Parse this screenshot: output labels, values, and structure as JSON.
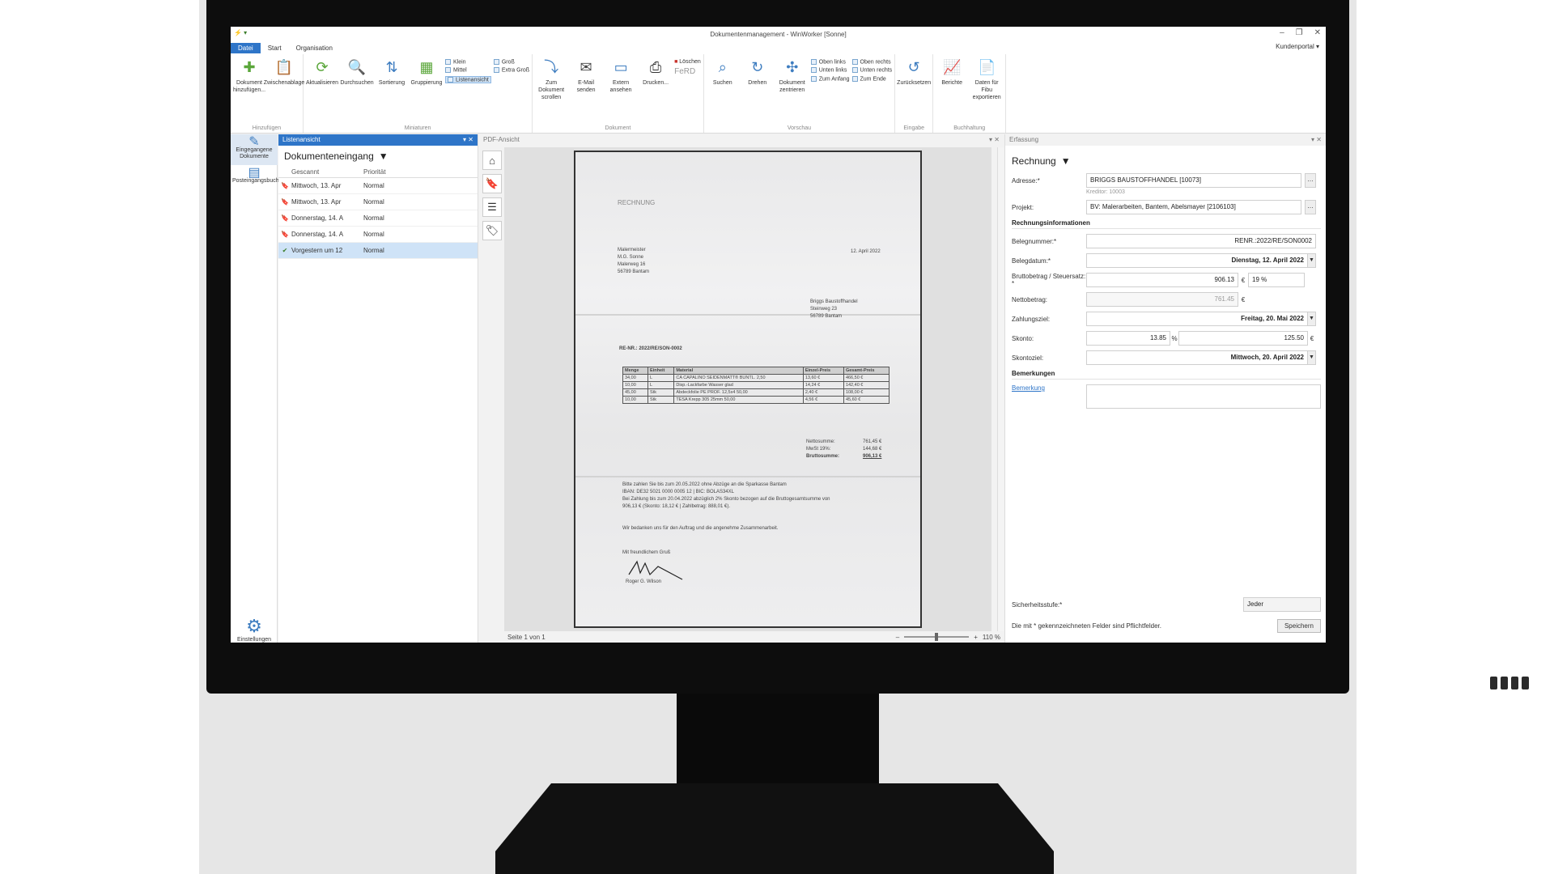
{
  "window": {
    "title": "Dokumentenmanagement - WinWorker [Sonne]",
    "quick_access": "⚡ ▾",
    "controls": [
      "–",
      "❐",
      "✕"
    ],
    "kundenportal": "Kundenportal ▾"
  },
  "menu": {
    "items": [
      "Datei",
      "Start",
      "Organisation"
    ],
    "active": "Datei"
  },
  "ribbon": {
    "groups": [
      {
        "label": "Hinzufügen",
        "buttons": [
          {
            "label": "Dokument hinzufügen...",
            "icon": "add-document-icon"
          },
          {
            "label": "Zwischenablage",
            "icon": "clipboard-icon"
          }
        ]
      },
      {
        "label": "Miniaturen",
        "buttons": [
          {
            "label": "Aktualisieren",
            "icon": "refresh-icon"
          },
          {
            "label": "Durchsuchen",
            "icon": "search-folder-icon"
          },
          {
            "label": "Sortierung",
            "icon": "sort-icon"
          },
          {
            "label": "Gruppierung",
            "icon": "group-icon"
          }
        ],
        "small": [
          "Klein",
          "Mittel",
          "Listenansicht",
          "Groß",
          "Extra Groß"
        ]
      },
      {
        "label": "Dokument",
        "buttons": [
          {
            "label": "Zum Dokument scrollen",
            "icon": "scroll-icon"
          },
          {
            "label": "E-Mail senden",
            "icon": "mail-icon"
          },
          {
            "label": "Extern ansehen",
            "icon": "external-icon"
          },
          {
            "label": "Drucken...",
            "icon": "print-icon"
          }
        ],
        "small": [
          "Löschen",
          "FeRD"
        ]
      },
      {
        "label": "Vorschau",
        "buttons": [
          {
            "label": "Suchen",
            "icon": "search-icon"
          },
          {
            "label": "Drehen",
            "icon": "rotate-icon"
          },
          {
            "label": "Dokument zentrieren",
            "icon": "center-icon"
          }
        ],
        "small": [
          "Oben links",
          "Unten links",
          "Zum Anfang",
          "Oben rechts",
          "Unten rechts",
          "Zum Ende"
        ]
      },
      {
        "label": "Eingabe",
        "buttons": [
          {
            "label": "Zurücksetzen",
            "icon": "reset-icon"
          }
        ]
      },
      {
        "label": "Buchhaltung",
        "buttons": [
          {
            "label": "Berichte",
            "icon": "report-icon"
          },
          {
            "label": "Daten für Fibu exportieren",
            "icon": "export-icon"
          }
        ]
      }
    ]
  },
  "nav": {
    "items": [
      {
        "label": "Eingegangene Dokumente",
        "icon": "inbox-icon"
      },
      {
        "label": "Posteingangsbuch",
        "icon": "book-icon"
      }
    ],
    "settings": "Einstellungen"
  },
  "list": {
    "pane_title": "Listenansicht",
    "view": "Dokumenteneingang",
    "columns": [
      "Gescannt",
      "Priorität"
    ],
    "rows": [
      {
        "scanned": "Mittwoch, 13. Apr",
        "priority": "Normal",
        "mark": "bookmark"
      },
      {
        "scanned": "Mittwoch, 13. Apr",
        "priority": "Normal",
        "mark": "bookmark"
      },
      {
        "scanned": "Donnerstag, 14. A",
        "priority": "Normal",
        "mark": "bookmark"
      },
      {
        "scanned": "Donnerstag, 14. A",
        "priority": "Normal",
        "mark": "bookmark"
      },
      {
        "scanned": "Vorgestern um 12",
        "priority": "Normal",
        "mark": "check"
      }
    ]
  },
  "pdf": {
    "pane_title": "PDF-Ansicht",
    "page_info": "Seite 1 von 1",
    "zoom": "110 %",
    "doc": {
      "heading": "RECHNUNG",
      "sender": [
        "Malermeister",
        "M.G. Sonne",
        "Malerweg 16",
        "56789 Bantam"
      ],
      "date": "12. April 2022",
      "recipient": [
        "Briggs Baustoffhandel",
        "Steinweg 23",
        "56789 Bantam"
      ],
      "invoice_no": "RE-NR.: 2022/RE/SON-0002",
      "table_header": [
        "Menge",
        "Einheit",
        "Material",
        "Einzel-Preis",
        "Gesamt-Preis"
      ],
      "table_rows": [
        [
          "34,00",
          "L",
          "CA CAPALINO SEIDENMATT® BUNTL. 2,50",
          "13,60 €",
          "466,50 €"
        ],
        [
          "10,00",
          "L",
          "Disp.-Lackfarbe Wasser glad",
          "14,24 €",
          "142,40 €"
        ],
        [
          "45,00",
          "Stk",
          "Abdeckfolie PE PROF. 12,5x4 50,00",
          "2,40 €",
          "108,00 €"
        ],
        [
          "10,00",
          "Stk",
          "TESA Krepp 305 25mm 50,00",
          "4,56 €",
          "45,60 €"
        ]
      ],
      "totals": [
        [
          "Nettosumme:",
          "761,45 €"
        ],
        [
          "MwSt 19%:",
          "144,68 €"
        ],
        [
          "Bruttosumme:",
          "906,13 €"
        ]
      ],
      "payment_lines": [
        "Bitte zahlen Sie bis zum 20.05.2022 ohne Abzüge an die Sparkasse Bantam",
        "IBAN: DE32 5021 0000 0005 12 | BIC: BOLAS34XL",
        "Bei Zahlung bis zum 20.04.2022 abzüglich 2% Skonto bezogen auf die Bruttogesamtsumme von",
        "906,13 € (Skonto: 18,12 € | Zahlbetrag: 888,01 €)."
      ],
      "thanks": "Wir bedanken uns für den Auftrag und die angenehme Zusammenarbeit.",
      "greeting": "Mit freundlichem Gruß",
      "signer": "Roger G. Wilson"
    }
  },
  "form": {
    "pane_title": "Erfassung",
    "doc_type": "Rechnung",
    "labels": {
      "address": "Adresse:*",
      "project": "Projekt:",
      "section_invoice": "Rechnungsinformationen",
      "beleg_nr": "Belegnummer:*",
      "beleg_date": "Belegdatum:*",
      "gross": "Bruttobetrag / Steuersatz: *",
      "net": "Nettobetrag:",
      "payment_term": "Zahlungsziel:",
      "discount": "Skonto:",
      "discount_due": "Skontoziel:",
      "section_remarks": "Bemerkungen",
      "remark": "Bemerkung",
      "security": "Sicherheitsstufe:*"
    },
    "values": {
      "address": "BRIGGS BAUSTOFFHANDEL [10073]",
      "creditor": "Kreditor: 10003",
      "project": "BV: Malerarbeiten, Bantem, Abelsmayer [2106103]",
      "beleg_nr": "RENR.:2022/RE/SON0002",
      "beleg_date": "Dienstag, 12. April 2022",
      "gross": "906.13",
      "currency": "€",
      "tax": "19 %",
      "net": "761.45",
      "payment_term": "Freitag, 20. Mai 2022",
      "discount_pct": "13.85",
      "percent": "%",
      "discount_amount": "125.50",
      "discount_due": "Mittwoch, 20. April 2022",
      "security": "Jeder"
    },
    "footer_note": "Die mit * gekennzeichneten Felder sind Pflichtfelder.",
    "save": "Speichern"
  },
  "colors": {
    "accent": "#2e75c8",
    "selection": "#cfe3f7",
    "bezel": "#0d0d0d"
  }
}
